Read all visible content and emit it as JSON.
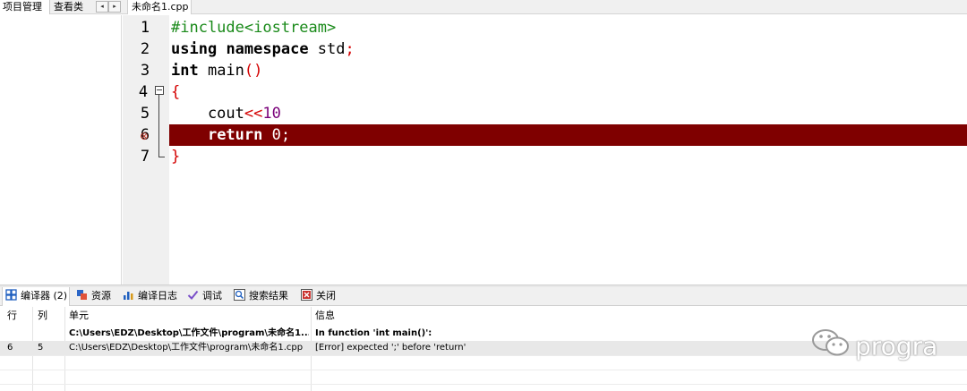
{
  "left_tabs": {
    "project": "项目管理",
    "classes": "查看类"
  },
  "nav_arrows": {
    "left": "◂",
    "right": "▸"
  },
  "file_tab": {
    "label": "未命名1.cpp"
  },
  "editor": {
    "line_numbers": [
      "1",
      "2",
      "3",
      "4",
      "5",
      "6",
      "7"
    ],
    "lines": {
      "l1_include": "#include<iostream>",
      "l2_using": "using",
      "l2_namespace": "namespace",
      "l2_std": " std",
      "l2_semi": ";",
      "l3_int": "int",
      "l3_main": " main",
      "l3_parens": "()",
      "l4_brace": "{",
      "l5_indent": "    cout",
      "l5_op": "<<",
      "l5_num": "10",
      "l6_indent": "    ",
      "l6_return": "return",
      "l6_rest": " 0;",
      "l7_brace": "}"
    },
    "error_line": "6",
    "error_highlight_color": "#7f0000"
  },
  "bottom_tabs": [
    {
      "label": "编译器 (2)",
      "icon": "grid-icon"
    },
    {
      "label": "资源",
      "icon": "resources-icon"
    },
    {
      "label": "编译日志",
      "icon": "chart-icon"
    },
    {
      "label": "调试",
      "icon": "check-icon"
    },
    {
      "label": "搜索结果",
      "icon": "search-icon"
    },
    {
      "label": "关闭",
      "icon": "close-icon"
    }
  ],
  "messages": {
    "headers": {
      "row": "行",
      "col": "列",
      "unit": "单元",
      "info": "信息"
    },
    "rows": [
      {
        "row": "",
        "col": "",
        "unit": "C:\\Users\\EDZ\\Desktop\\工作文件\\program\\未命名1....",
        "info": "In function 'int main()':",
        "bold": true
      },
      {
        "row": "6",
        "col": "5",
        "unit": "C:\\Users\\EDZ\\Desktop\\工作文件\\program\\未命名1.cpp",
        "info": "[Error] expected ';' before 'return'",
        "bold": false
      }
    ]
  },
  "watermark": {
    "text": "progra"
  }
}
